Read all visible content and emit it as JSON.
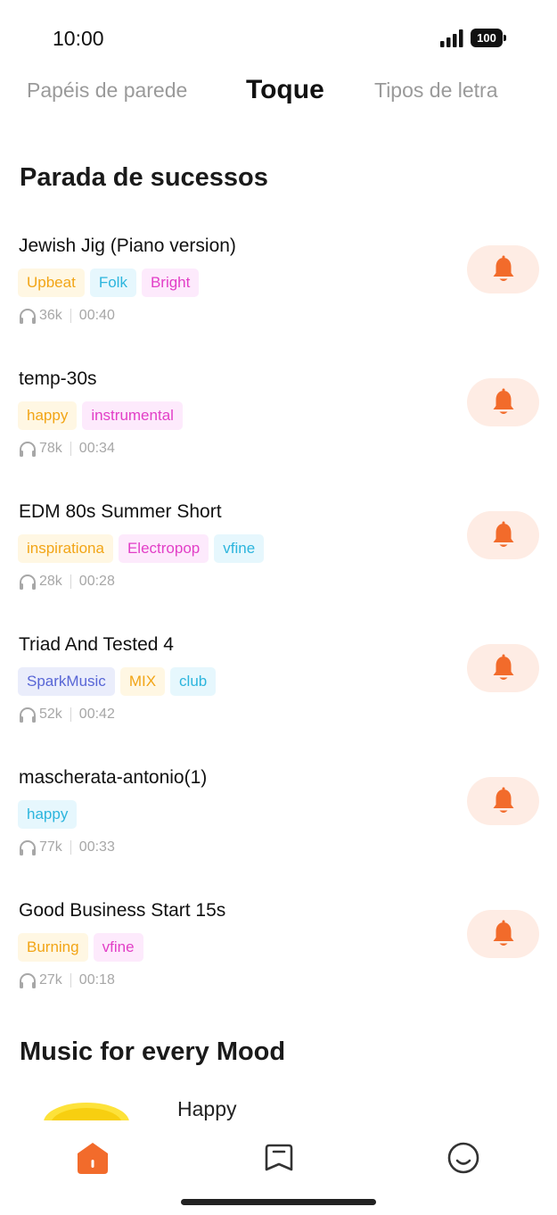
{
  "status": {
    "time": "10:00",
    "battery": "100"
  },
  "tabs": [
    {
      "label": "Papéis de parede",
      "active": false
    },
    {
      "label": "Toque",
      "active": true
    },
    {
      "label": "Tipos de letra",
      "active": false
    }
  ],
  "chart_section": {
    "title": "Parada de sucessos"
  },
  "songs": [
    {
      "title": "Jewish Jig (Piano version)",
      "tags": [
        "Upbeat",
        "Folk",
        "Bright"
      ],
      "plays": "36k",
      "duration": "00:40"
    },
    {
      "title": "temp-30s",
      "tags": [
        "happy",
        "instrumental"
      ],
      "plays": "78k",
      "duration": "00:34"
    },
    {
      "title": "EDM 80s Summer Short",
      "tags": [
        "inspirationa",
        "Electropop",
        "vfine"
      ],
      "plays": "28k",
      "duration": "00:28"
    },
    {
      "title": "Triad And Tested 4",
      "tags": [
        "SparkMusic",
        "MIX",
        "club"
      ],
      "plays": "52k",
      "duration": "00:42"
    },
    {
      "title": "mascherata-antonio(1)",
      "tags": [
        "happy"
      ],
      "plays": "77k",
      "duration": "00:33"
    },
    {
      "title": "Good Business Start 15s",
      "tags": [
        "Burning",
        "vfine"
      ],
      "plays": "27k",
      "duration": "00:18"
    }
  ],
  "mood_section": {
    "title": "Music for every Mood",
    "first_item": "Happy"
  },
  "colors": {
    "accent": "#f26b2b",
    "ring_button_bg": "#feece4",
    "tag_orange": "#f2a516",
    "tag_blue": "#2cb5dd",
    "tag_pink": "#e23fc7",
    "tag_indigo": "#5866d6"
  },
  "icons": {
    "ring_button": "bell-icon",
    "plays": "headphones-icon",
    "nav": [
      "home-icon",
      "bookmark-icon",
      "smiley-icon"
    ]
  }
}
